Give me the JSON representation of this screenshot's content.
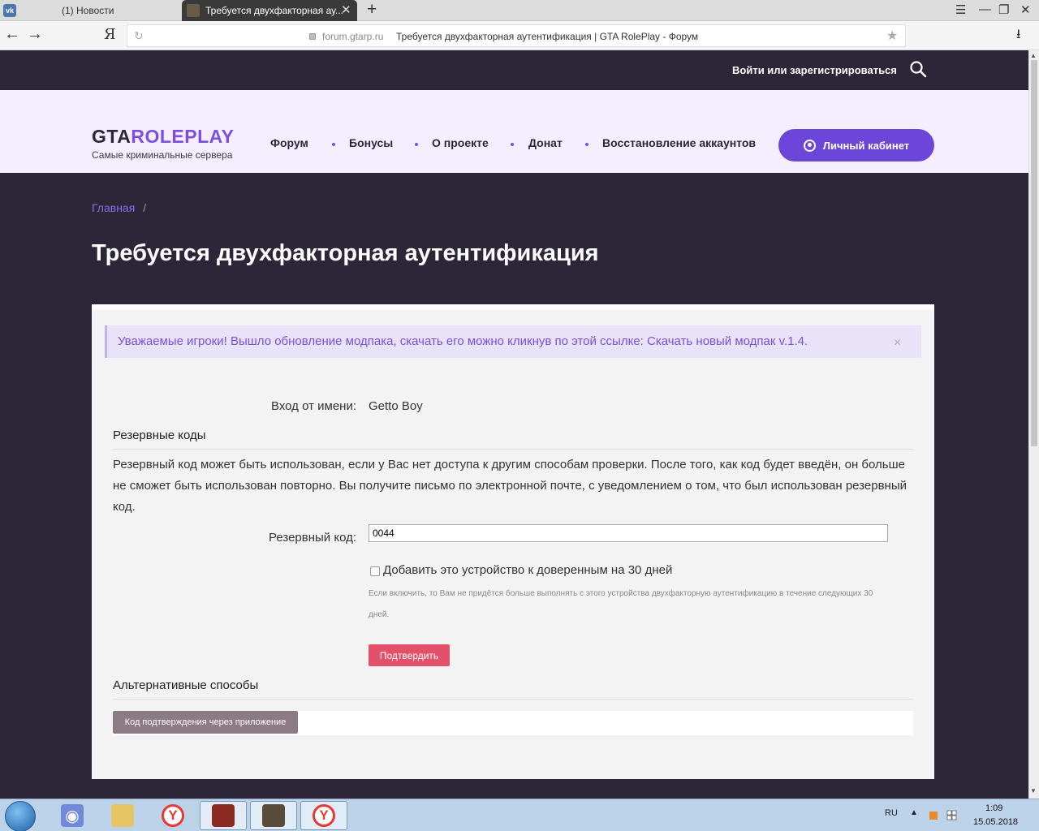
{
  "browser": {
    "tabs": [
      {
        "label": "(1) Новости",
        "icon": "vk-icon"
      },
      {
        "label": "Требуется двухфакторная ау...",
        "icon": "site-favicon"
      }
    ],
    "new_tab": "+",
    "vk_letter": "vk",
    "yandex_letter": "Я",
    "address_domain": "forum.gtarp.ru",
    "address_title": "Требуется двухфакторная аутентификация | GTA RolePlay - Форум"
  },
  "topbar": {
    "login_link": "Войти или зарегистрироваться"
  },
  "header": {
    "logo_main": "GTA",
    "logo_accent": "ROLEPLAY",
    "logo_subtitle": "Самые криминальные сервера",
    "menu": [
      "Форум",
      "Бонусы",
      "О проекте",
      "Донат",
      "Восстановление аккаунтов"
    ],
    "cabinet_button": "Личный кабинет",
    "accent_color": "#6c46d8"
  },
  "page": {
    "breadcrumb_home": "Главная",
    "breadcrumb_sep": "/",
    "title": "Требуется двухфакторная аутентификация"
  },
  "notice": {
    "text": "Уважаемые игроки! Вышло обновление модпака, скачать его можно кликнув по этой ссылке: Скачать новый модпак v.1.4.",
    "close": "×"
  },
  "form": {
    "login_as_label": "Вход от имени:",
    "login_as_value": "Getto Boy",
    "backup_section": "Резервные коды",
    "backup_description": "Резервный код может быть использован, если у Вас нет доступа к другим способам проверки. После того, как код будет введён, он больше не сможет быть использован повторно. Вы получите письмо по электронной почте, с уведомлением о том, что был использован резервный код.",
    "code_label": "Резервный код:",
    "code_value": "0044",
    "trust_label": "Добавить это устройство к доверенным на 30 дней",
    "trust_hint": "Если включить, то Вам не придётся больше выполнять с этого устройства двухфакторную аутентификацию в течение следующих 30 дней.",
    "confirm_button": "Подтвердить",
    "alt_section": "Альтернативные способы",
    "alt_button": "Код подтверждения через приложение"
  },
  "taskbar": {
    "lang": "RU",
    "time": "1:09",
    "date": "15.05.2018"
  }
}
